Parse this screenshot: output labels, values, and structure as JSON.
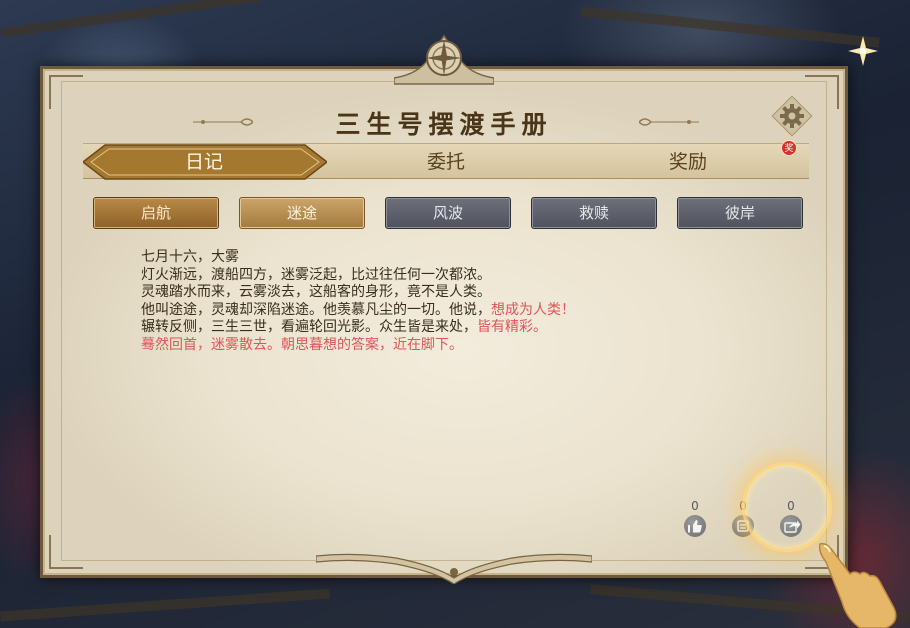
{
  "title": "三生号摆渡手册",
  "tabs": [
    {
      "label": "日记",
      "active": true
    },
    {
      "label": "委托",
      "active": false
    },
    {
      "label": "奖励",
      "active": false,
      "badge": "奖"
    }
  ],
  "chapters": [
    {
      "label": "启航",
      "state": "done"
    },
    {
      "label": "迷途",
      "state": "current"
    },
    {
      "label": "风波",
      "state": "locked"
    },
    {
      "label": "救赎",
      "state": "locked"
    },
    {
      "label": "彼岸",
      "state": "locked"
    }
  ],
  "diary": {
    "line1": "七月十六，大雾",
    "line2": "灯火渐远，渡船四方，迷雾泛起，比过往任何一次都浓。",
    "line3": "灵魂踏水而来，云雾淡去，这船客的身形，竟不是人类。",
    "line4_a": "他叫途途，灵魂却深陷迷途。他羡慕凡尘的一切。他说，",
    "line4_b": "想成为人类！",
    "line5_a": "辗转反侧，三生三世，看遍轮回光影。众生皆是来处，",
    "line5_b": "皆有精彩。",
    "line6": "蓦然回首，迷雾散去。朝思暮想的答案，近在脚下。"
  },
  "social": {
    "like_count": "0",
    "comment_count": "0",
    "share_count": "0"
  },
  "icons": {
    "settings": "gear-icon",
    "like": "thumbs-up-icon",
    "comment": "comment-icon",
    "share": "share-icon"
  },
  "colors": {
    "parchment": "#efe7d4",
    "title_text": "#4a3519",
    "highlight_text": "#e0555a",
    "active_tab": "#a5782f",
    "locked_button": "#5e6169"
  }
}
